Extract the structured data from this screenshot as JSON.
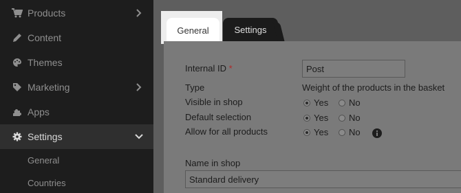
{
  "sidebar": {
    "items": [
      {
        "label": "Products",
        "icon": "cart-icon",
        "chevron": "chevron-right"
      },
      {
        "label": "Content",
        "icon": "pencil-icon"
      },
      {
        "label": "Themes",
        "icon": "palette-icon"
      },
      {
        "label": "Marketing",
        "icon": "tag-icon",
        "chevron": "chevron-right"
      },
      {
        "label": "Apps",
        "icon": "puzzle-icon"
      },
      {
        "label": "Settings",
        "icon": "gear-icon",
        "chevron": "chevron-down",
        "active": true
      }
    ],
    "subitems": [
      {
        "label": "General"
      },
      {
        "label": "Countries"
      }
    ]
  },
  "tabs": [
    {
      "label": "General",
      "active": true
    },
    {
      "label": "Settings"
    }
  ],
  "form": {
    "internal_id": {
      "label": "Internal ID",
      "required": "*",
      "value": "Post"
    },
    "type": {
      "label": "Type",
      "value": "Weight of the products in the basket"
    },
    "visible": {
      "label": "Visible in shop",
      "yes": "Yes",
      "no": "No",
      "selected": "yes"
    },
    "default": {
      "label": "Default selection",
      "yes": "Yes",
      "no": "No",
      "selected": "yes"
    },
    "allow_all": {
      "label": "Allow for all products",
      "yes": "Yes",
      "no": "No",
      "selected": "yes"
    },
    "name_in_shop": {
      "label": "Name in shop",
      "value": "Standard delivery"
    }
  },
  "colors": {
    "sidebar_bg": "#1d1d1d",
    "sidebar_active": "#2f2f2f",
    "required": "#b02a2a"
  }
}
